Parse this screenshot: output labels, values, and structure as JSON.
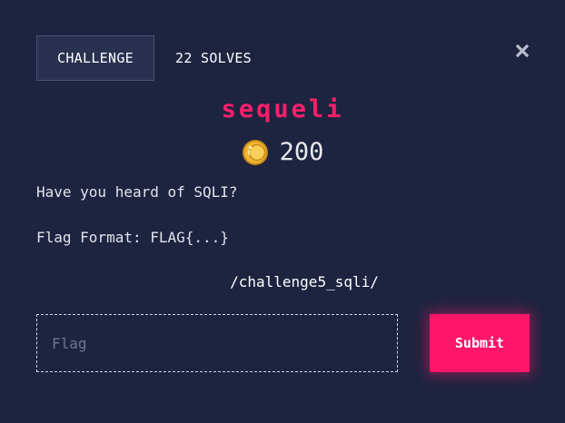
{
  "tabs": {
    "challenge_label": "CHALLENGE",
    "solves_label": "22 SOLVES"
  },
  "close_icon": "close-icon",
  "challenge": {
    "name": "sequeli",
    "coin_icon": "coin-icon",
    "points": "200",
    "description_lines": [
      "Have you heard of SQLI?",
      "Flag Format: FLAG{...}"
    ],
    "link_text": "/challenge5_sqli/"
  },
  "form": {
    "flag_placeholder": "Flag",
    "flag_value": "",
    "submit_label": "Submit"
  },
  "colors": {
    "background": "#1e2440",
    "accent": "#ff1669",
    "title": "#ff1f6b",
    "tab_active_bg": "#2a3150",
    "coin": "#f2b632"
  }
}
